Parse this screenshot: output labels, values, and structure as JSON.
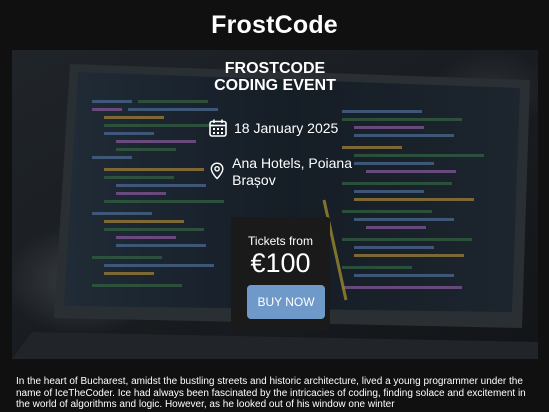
{
  "site": {
    "title": "FrostCode"
  },
  "event": {
    "title_line1": "FROSTCODE",
    "title_line2": "CODING EVENT",
    "date": "18 January 2025",
    "location": "Ana Hotels, Poiana Brașov",
    "tickets_label": "Tickets from",
    "price": "€100",
    "buy_label": "BUY NOW"
  },
  "story": {
    "text": "In the heart of Bucharest, amidst the bustling streets and historic architecture, lived a young programmer under the name of IceTheCoder. Ice had always been fascinated by the intricacies of coding, finding solace and excitement in the world of algorithms and logic. However, as he looked out of his window one winter"
  },
  "colors": {
    "page_background": "#101010",
    "button": "#6f99c9",
    "ticket_card": "#1a1a1a",
    "code_highlight": "#d8c23a"
  },
  "icons": {
    "date": "calendar-icon",
    "location": "map-pin-icon"
  }
}
